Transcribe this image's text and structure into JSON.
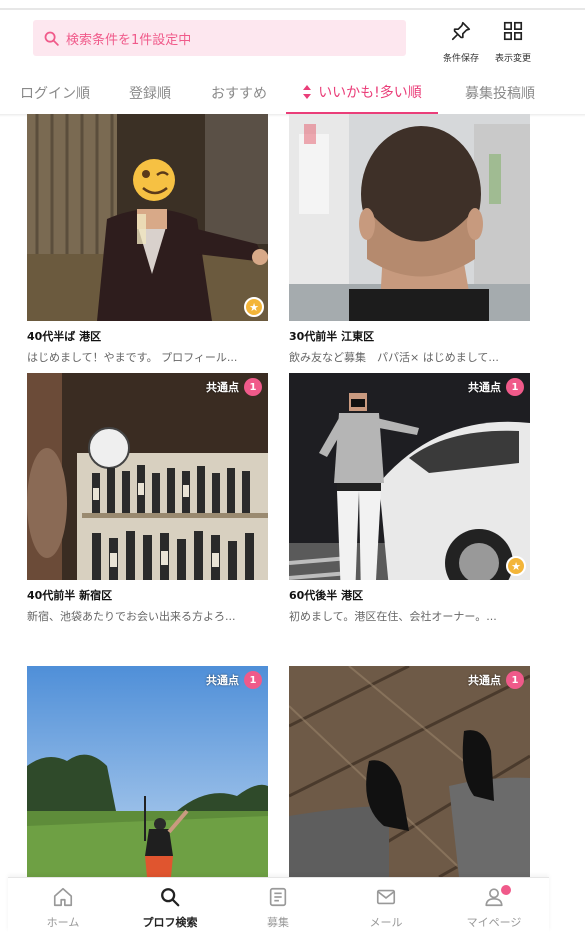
{
  "search": {
    "placeholder_text": "検索条件を1件設定中",
    "icon": "search-icon"
  },
  "header_actions": {
    "save_label": "条件保存",
    "save_icon": "pin-icon",
    "view_label": "表示変更",
    "view_icon": "grid-icon"
  },
  "tabs": [
    {
      "label": "ログイン順"
    },
    {
      "label": "登録順"
    },
    {
      "label": "おすすめ"
    },
    {
      "label": "いいかも!多い順",
      "active": true
    },
    {
      "label": "募集投稿順"
    }
  ],
  "common_label": "共通点",
  "cards": [
    {
      "title": "40代半ば 港区",
      "desc": "はじめまして！やまです。 プロフィール...",
      "common_count": null,
      "star": true
    },
    {
      "title": "30代前半 江東区",
      "desc": "飲み友など募集　パパ活× はじめまして...",
      "common_count": null,
      "star": false
    },
    {
      "title": "40代前半 新宿区",
      "desc": "新宿、池袋あたりでお会い出来る方よろ...",
      "common_count": "1",
      "star": false
    },
    {
      "title": "60代後半 港区",
      "desc": "初めまして。港区在住、会社オーナー。...",
      "common_count": "1",
      "star": true
    },
    {
      "title": "",
      "desc": "",
      "common_count": "1",
      "star": false
    },
    {
      "title": "",
      "desc": "",
      "common_count": "1",
      "star": false
    }
  ],
  "nav": [
    {
      "label": "ホーム",
      "icon": "home-icon"
    },
    {
      "label": "プロフ検索",
      "icon": "search-icon",
      "active": true
    },
    {
      "label": "募集",
      "icon": "board-icon"
    },
    {
      "label": "メール",
      "icon": "mail-icon"
    },
    {
      "label": "マイページ",
      "icon": "person-icon",
      "notification": true
    }
  ],
  "colors": {
    "accent": "#ea3e79",
    "search_bg": "#fde7ef",
    "star": "#f3b539"
  }
}
